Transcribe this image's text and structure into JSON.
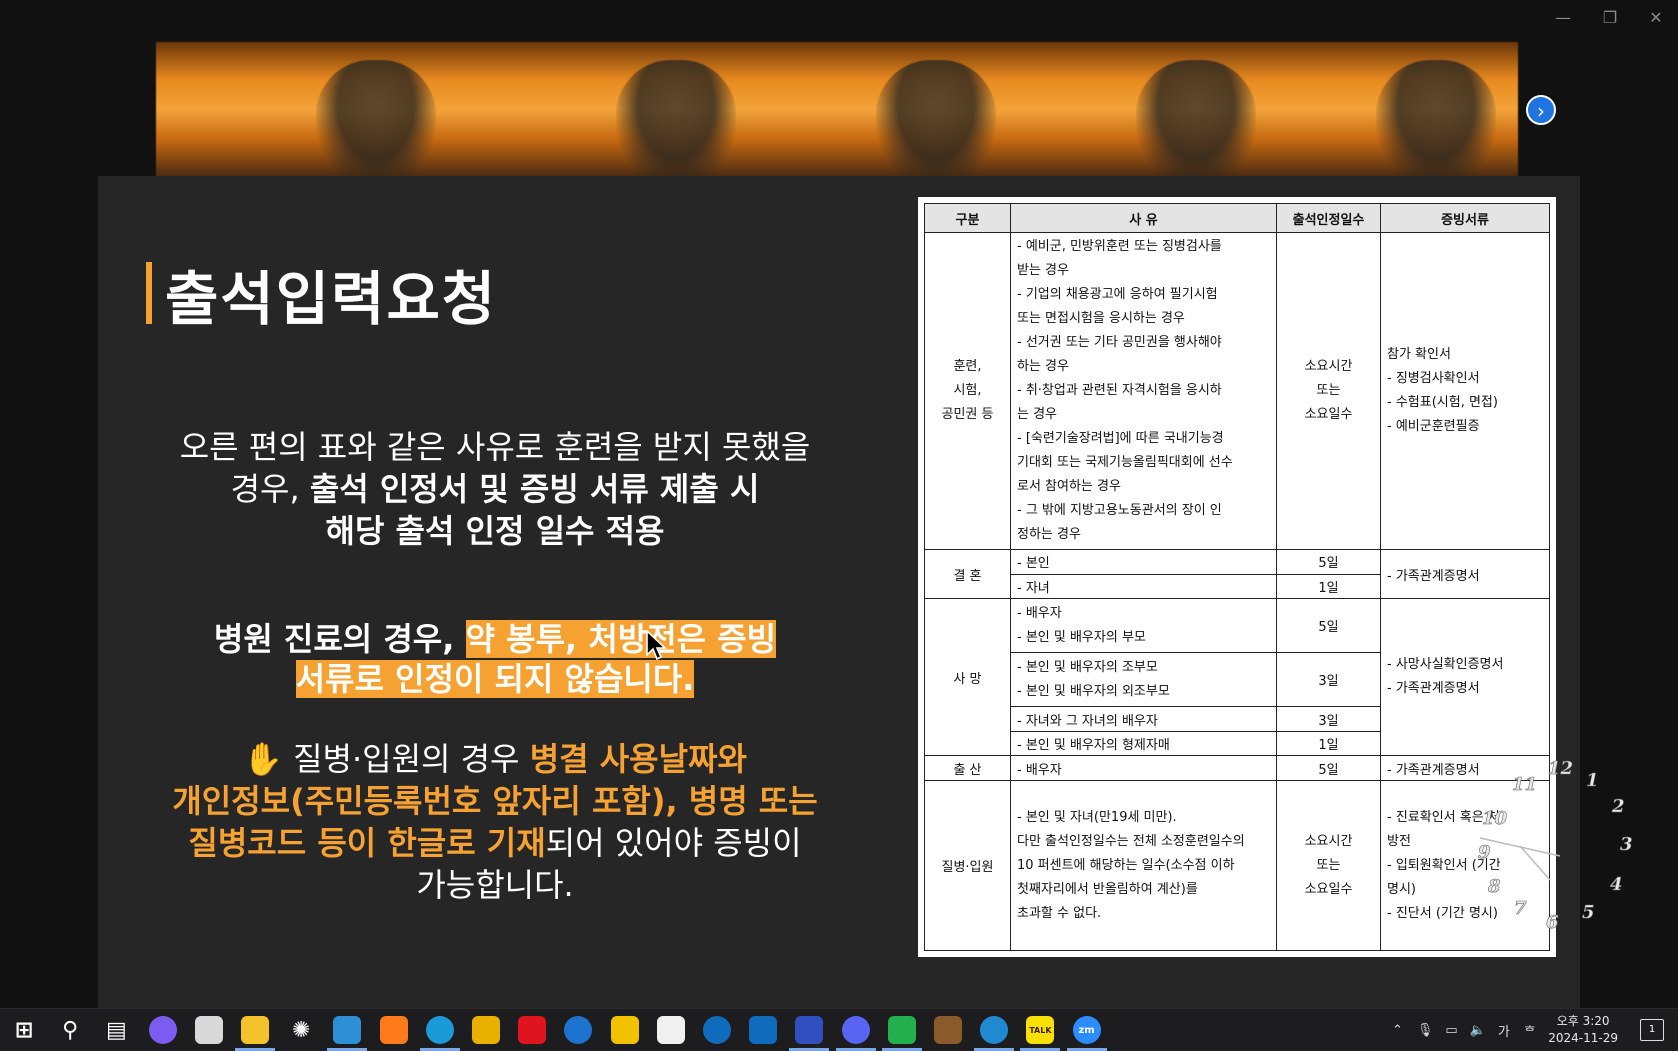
{
  "window": {
    "min": "—",
    "restore": "❐",
    "close": "✕"
  },
  "slide": {
    "title": "출석입력요청",
    "p1_line1": "오른 편의 표와 같은 사유로 훈련을 받지 못했을",
    "p1_line2a": "경우, ",
    "p1_line2b": "출석 인정서 및 증빙 서류 제출 시",
    "p1_line3": "해당 출석 인정 일수 적용",
    "p2_a": "병원 진료의 경우, ",
    "p2_b": "약 봉투, 처방전은 증빙",
    "p2_c": "서류로 인정이 되지 않습니다.",
    "p3_icon": "✋",
    "p3_a": "질병·입원의 경우 ",
    "p3_b": "병결 사용날짜와",
    "p3_c": "개인정보(주민등록번호 앞자리 포함), 병명 또는",
    "p3_d": "질병코드 등이 한글로 기재",
    "p3_e": "되어 있어야 증빙이",
    "p3_f": "가능합니다."
  },
  "table": {
    "headers": [
      "구분",
      "사  유",
      "출석인정일수",
      "증빙서류"
    ],
    "training": {
      "category": [
        "훈련,",
        "시험,",
        "공민권 등"
      ],
      "reasons": [
        "- 예비군, 민방위훈련 또는 징병검사를",
        "받는 경우",
        "- 기업의 채용광고에 응하여 필기시험",
        "또는 면접시험을 응시하는 경우",
        "- 선거권 또는 기타 공민권을 행사해야",
        "하는 경우",
        "- 취·창업과 관련된 자격시험을 응시하",
        "는 경우",
        "- [숙련기술장려법]에 따른 국내기능경",
        "기대회 또는 국제기능올림픽대회에 선수",
        "로서 참여하는 경우",
        "- 그 밖에 지방고용노동관서의 장이 인",
        "정하는 경우"
      ],
      "days": [
        "소요시간",
        "또는",
        "소요일수"
      ],
      "docs": [
        "참가 확인서",
        "- 징병검사확인서",
        "- 수험표(시험, 면접)",
        "- 예비군훈련필증"
      ]
    },
    "marriage": {
      "category": "결  혼",
      "rows": [
        {
          "reason": "- 본인",
          "days": "5일"
        },
        {
          "reason": "- 자녀",
          "days": "1일"
        }
      ],
      "docs": "- 가족관계증명서"
    },
    "death": {
      "category": "사  망",
      "g1": [
        "- 배우자",
        "- 본인 및 배우자의 부모"
      ],
      "g1_days": "5일",
      "g2": [
        "- 본인 및 배우자의 조부모",
        "- 본인 및 배우자의 외조부모"
      ],
      "g2_days": "3일",
      "g3": "- 자녀와 그 자녀의 배우자",
      "g3_days": "3일",
      "g4": "- 본인 및 배우자의 형제자매",
      "g4_days": "1일",
      "docs": [
        "- 사망사실확인증명서",
        "- 가족관계증명서"
      ]
    },
    "birth": {
      "category": "출  산",
      "reason": "- 배우자",
      "days": "5일",
      "docs": "- 가족관계증명서"
    },
    "illness": {
      "category": "질병·입원",
      "reasons": [
        "- 본인 및 자녀(만19세 미만).",
        "다만 출석인정일수는 전체 소정훈련일수의",
        "10 퍼센트에 해당하는 일수(소수점 이하",
        "첫째자리에서 반올림하여 계산)를",
        "초과할 수 없다."
      ],
      "days": [
        "소요시간",
        "또는",
        "소요일수"
      ],
      "docs": [
        "-  진료확인서 혹은 처",
        "방전",
        "-  입퇴원확인서  (기간",
        "명시)",
        "- 진단서 (기간 명시)"
      ]
    }
  },
  "clock_numbers": [
    "12",
    "1",
    "2",
    "3",
    "4",
    "5",
    "6",
    "7",
    "8",
    "9",
    "10",
    "11"
  ],
  "taskbar": {
    "apps": [
      "start-icon",
      "search-icon",
      "task-view-icon",
      "copilot-icon",
      "clock-app-icon",
      "app-icon",
      "chatgpt-icon",
      "app-icon",
      "firefox-icon",
      "edge-icon",
      "chrome-icon",
      "opera-icon",
      "ie-icon",
      "file-explorer-icon",
      "store-icon",
      "outlook-icon",
      "outlook-new-icon",
      "app-icon",
      "discord-icon",
      "sync-icon",
      "app-icon",
      "vscode-icon",
      "kakaotalk-icon",
      "zoom-icon"
    ],
    "kakao_label": "TALK",
    "zoom_label": "zm",
    "ime": "가",
    "time": "오후 3:20",
    "date": "2024-11-29",
    "notif_count": "1"
  }
}
